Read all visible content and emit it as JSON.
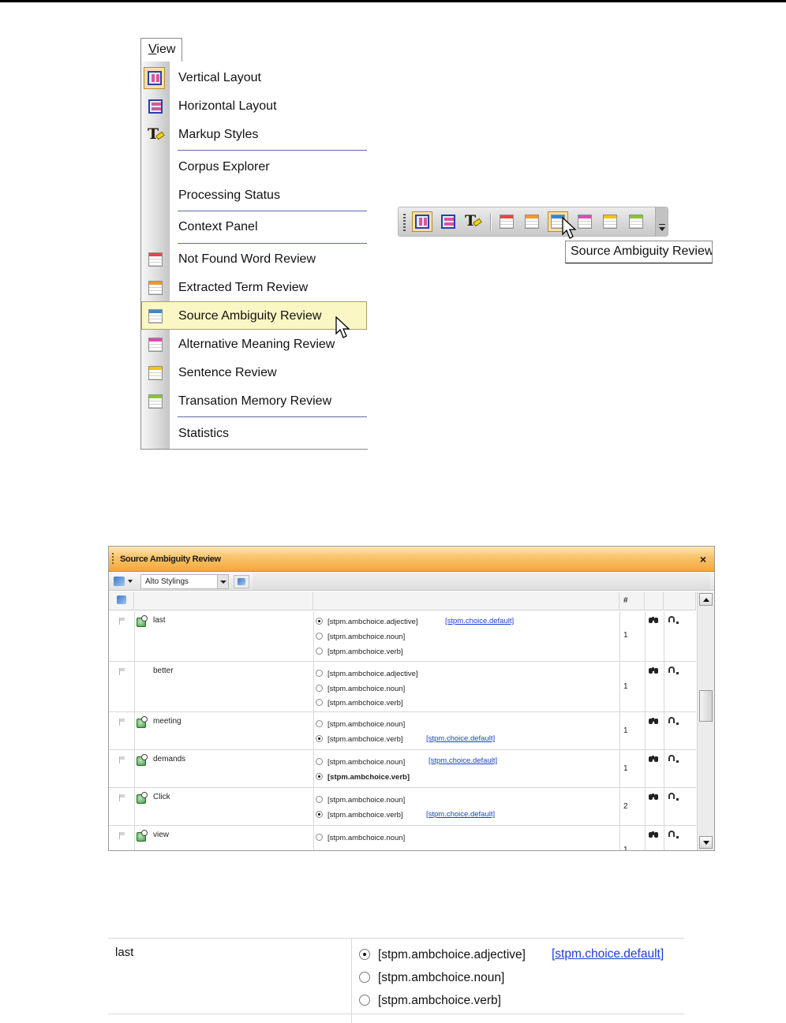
{
  "view_menu": {
    "title_underlined": "V",
    "title_rest": "iew",
    "items": [
      {
        "label": "Vertical Layout",
        "icon": "vertical-layout-icon"
      },
      {
        "label": "Horizontal Layout",
        "icon": "horizontal-layout-icon"
      },
      {
        "label": "Markup Styles",
        "icon": "markup-styles-icon"
      },
      {
        "label": "Corpus Explorer",
        "icon": ""
      },
      {
        "label": "Processing Status",
        "icon": ""
      },
      {
        "label": "Context Panel",
        "icon": ""
      },
      {
        "label": "Not Found Word Review",
        "icon": "not-found-word-review-icon",
        "color": "#e04a4a"
      },
      {
        "label": "Extracted Term Review",
        "icon": "extracted-term-review-icon",
        "color": "#f09a2a"
      },
      {
        "label": "Source Ambiguity Review",
        "icon": "source-ambiguity-review-icon",
        "color": "#3a86d6"
      },
      {
        "label": "Alternative Meaning Review",
        "icon": "alternative-meaning-review-icon",
        "color": "#e04ab0"
      },
      {
        "label": "Sentence Review",
        "icon": "sentence-review-icon",
        "color": "#f2c21a"
      },
      {
        "label": "Transation Memory Review",
        "icon": "translation-memory-review-icon",
        "color": "#8cc23a"
      },
      {
        "label": "Statistics",
        "icon": ""
      }
    ],
    "highlighted_item": "Source Ambiguity Review",
    "highlight_color": "#fbf7c4"
  },
  "toolbar": {
    "tooltip": "Source Ambiguity Review",
    "buttons": [
      "vertical-layout-icon",
      "horizontal-layout-icon",
      "markup-styles-icon",
      "not-found-word-review-icon",
      "extracted-term-review-icon",
      "source-ambiguity-review-icon",
      "alternative-meaning-review-icon",
      "sentence-review-icon",
      "translation-memory-review-icon"
    ]
  },
  "panel": {
    "title": "Source Ambiguity Review",
    "close": "×",
    "header_color": "#f5ae45",
    "style_select": "Alto Stylings",
    "count_header": "#",
    "rows": [
      {
        "term": "last",
        "has_icon": true,
        "count": "1",
        "choices": [
          {
            "text": "[stpm.ambchoice.adjective]",
            "selected": true,
            "default": "[stpm.choice.default]"
          },
          {
            "text": "[stpm.ambchoice.noun]",
            "selected": false
          },
          {
            "text": "[stpm.ambchoice.verb]",
            "selected": false
          }
        ]
      },
      {
        "term": "better",
        "has_icon": false,
        "count": "1",
        "choices": [
          {
            "text": "[stpm.ambchoice.adjective]",
            "selected": false
          },
          {
            "text": "[stpm.ambchoice.noun]",
            "selected": false
          },
          {
            "text": "[stpm.ambchoice.verb]",
            "selected": false
          }
        ]
      },
      {
        "term": "meeting",
        "has_icon": true,
        "count": "1",
        "choices": [
          {
            "text": "[stpm.ambchoice.noun]",
            "selected": false
          },
          {
            "text": "[stpm.ambchoice.verb]",
            "selected": true,
            "default": "[stpm.choice.default]"
          }
        ]
      },
      {
        "term": "demands",
        "has_icon": true,
        "count": "1",
        "choices": [
          {
            "text": "[stpm.ambchoice.noun]",
            "selected": false,
            "default": "[stpm.choice.default]"
          },
          {
            "text": "[stpm.ambchoice.verb]",
            "selected": true,
            "bold": true
          }
        ]
      },
      {
        "term": "Click",
        "has_icon": true,
        "count": "2",
        "choices": [
          {
            "text": "[stpm.ambchoice.noun]",
            "selected": false
          },
          {
            "text": "[stpm.ambchoice.verb]",
            "selected": true,
            "default": "[stpm.choice.default]"
          }
        ]
      },
      {
        "term": "view",
        "has_icon": true,
        "count": "1",
        "choices": [
          {
            "text": "[stpm.ambchoice.noun]",
            "selected": false
          }
        ]
      }
    ]
  },
  "detail": {
    "term": "last",
    "choices": [
      {
        "text": "[stpm.ambchoice.adjective]",
        "selected": true
      },
      {
        "text": "[stpm.ambchoice.noun]",
        "selected": false
      },
      {
        "text": "[stpm.ambchoice.verb]",
        "selected": false
      }
    ],
    "default_link": "[stpm.choice.default]"
  }
}
